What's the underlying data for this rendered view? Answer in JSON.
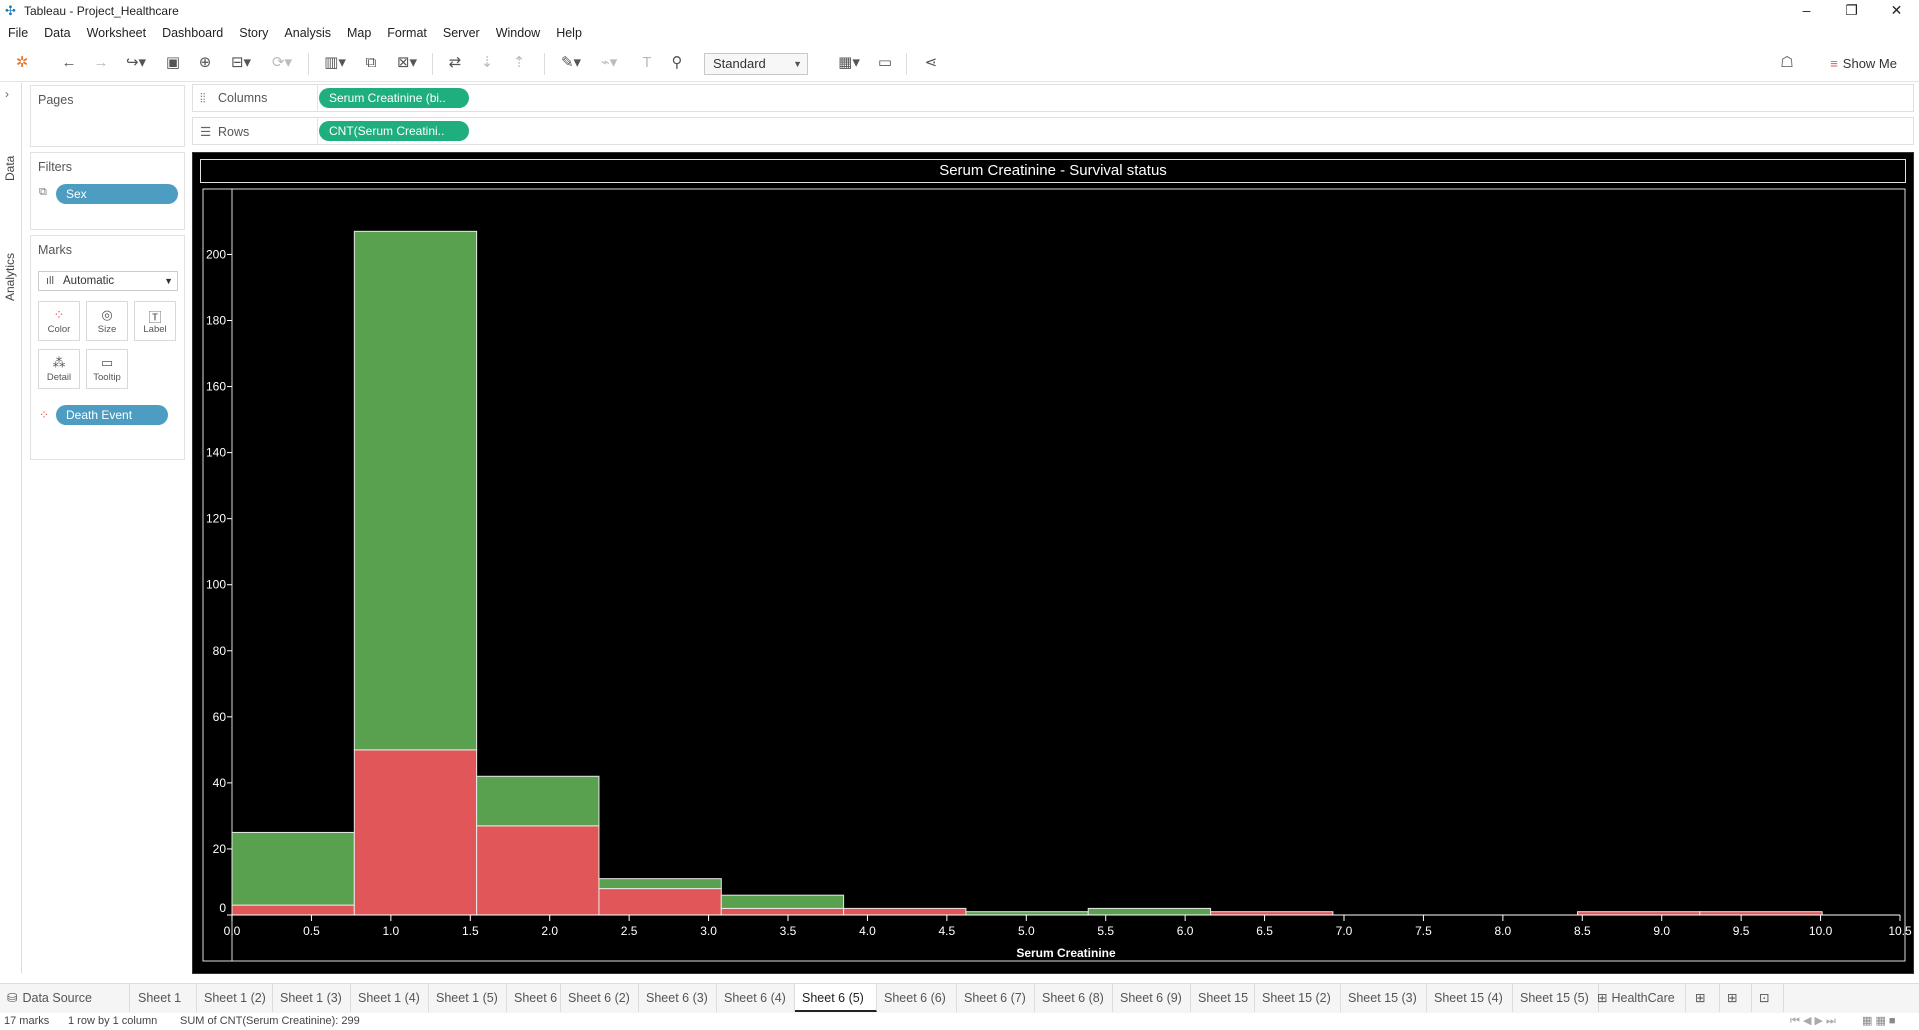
{
  "window": {
    "title": "Tableau - Project_Healthcare",
    "minimize": "–",
    "restore": "❐",
    "close": "✕"
  },
  "menu": [
    "File",
    "Data",
    "Worksheet",
    "Dashboard",
    "Story",
    "Analysis",
    "Map",
    "Format",
    "Server",
    "Window",
    "Help"
  ],
  "toolbar": {
    "fit_select": "Standard",
    "show_me": "Show Me"
  },
  "sidebar": {
    "data_tab": "Data",
    "analytics_tab": "Analytics"
  },
  "pages": {
    "title": "Pages"
  },
  "filters": {
    "title": "Filters",
    "pill": "Sex"
  },
  "marks": {
    "title": "Marks",
    "type": "Automatic",
    "cards": [
      "Color",
      "Size",
      "Label",
      "Detail",
      "Tooltip"
    ],
    "color_pill": "Death Event"
  },
  "shelves": {
    "columns_label": "Columns",
    "columns_pill": "Serum Creatinine (bi..",
    "rows_label": "Rows",
    "rows_pill": "CNT(Serum Creatini.."
  },
  "colors": {
    "survived": "#59a14f",
    "died": "#e15759",
    "pill_green": "#1fae7e",
    "pill_blue": "#4d9cc2"
  },
  "chart_data": {
    "type": "bar",
    "stacked": true,
    "title": "Serum Creatinine  - Survival status",
    "xlabel": "Serum Creatinine",
    "ylabel": "",
    "xlim": [
      0.0,
      10.5
    ],
    "ylim": [
      0,
      218
    ],
    "x_ticks": [
      "0.0",
      "0.5",
      "1.0",
      "1.5",
      "2.0",
      "2.5",
      "3.0",
      "3.5",
      "4.0",
      "4.5",
      "5.0",
      "5.5",
      "6.0",
      "6.5",
      "7.0",
      "7.5",
      "8.0",
      "8.5",
      "9.0",
      "9.5",
      "10.0",
      "10.5"
    ],
    "y_ticks": [
      0,
      20,
      40,
      60,
      80,
      100,
      120,
      140,
      160,
      180,
      200
    ],
    "bin_width": 0.77,
    "bin_starts": [
      0.0,
      0.77,
      1.54,
      2.31,
      3.08,
      3.85,
      4.62,
      5.39,
      6.16,
      6.93,
      7.7,
      8.47,
      9.24
    ],
    "series": [
      {
        "values": [
          3,
          50,
          27,
          8,
          2,
          2,
          0,
          0,
          1,
          0,
          0,
          1,
          1
        ]
      },
      {
        "values": [
          22,
          157,
          15,
          3,
          4,
          0,
          1,
          2,
          0,
          0,
          0,
          0,
          0
        ]
      }
    ],
    "grid": false,
    "legend": "none"
  },
  "sheet_tabs": {
    "data_source": "Data Source",
    "sheets": [
      "Sheet 1",
      "Sheet 1 (2)",
      "Sheet 1 (3)",
      "Sheet 1 (4)",
      "Sheet 1 (5)",
      "Sheet 6",
      "Sheet 6 (2)",
      "Sheet 6 (3)",
      "Sheet 6 (4)",
      "Sheet 6 (5)",
      "Sheet 6 (6)",
      "Sheet 6 (7)",
      "Sheet 6 (8)",
      "Sheet 6 (9)",
      "Sheet 15",
      "Sheet 15 (2)",
      "Sheet 15 (3)",
      "Sheet 15 (4)",
      "Sheet 15 (5)"
    ],
    "active": "Sheet 6 (5)",
    "dashboard": "HealthCare"
  },
  "status": {
    "marks": "17 marks",
    "layout": "1 row by 1 column",
    "sum": "SUM of CNT(Serum Creatinine): 299"
  }
}
